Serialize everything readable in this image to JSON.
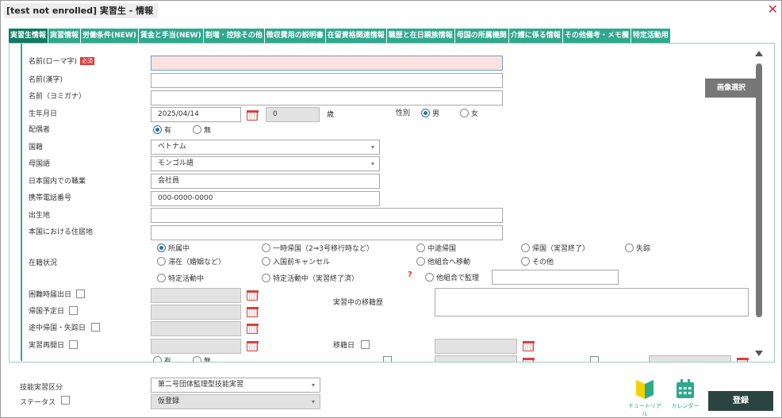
{
  "window": {
    "title": "[test not enrolled] 実習生 - 情報",
    "close_symbol": "✕"
  },
  "tabs": [
    {
      "label": "実習生情報",
      "active": true
    },
    {
      "label": "実習情報"
    },
    {
      "label": "労働条件(NEW)"
    },
    {
      "label": "賃金と手当(NEW)"
    },
    {
      "label": "割増・控除その他"
    },
    {
      "label": "徴収費用の説明書"
    },
    {
      "label": "在留資格関連情報"
    },
    {
      "label": "職歴と在日親族情報"
    },
    {
      "label": "母国の所属機関"
    },
    {
      "label": "介護に係る情報"
    },
    {
      "label": "その他備考・メモ欄"
    },
    {
      "label": "特定活動用"
    }
  ],
  "form": {
    "name_roman": {
      "label": "名前(ローマ字)",
      "badge": "必須",
      "value": ""
    },
    "name_kanji": {
      "label": "名前(漢字)",
      "value": ""
    },
    "name_kana": {
      "label": "名前（ヨミガナ）",
      "value": ""
    },
    "birthdate": {
      "label": "生年月日",
      "value": "2025/04/14",
      "age": "0",
      "age_unit": "歳"
    },
    "gender": {
      "label": "性別",
      "options": [
        "男",
        "女"
      ],
      "selected": "男"
    },
    "spouse": {
      "label": "配偶者",
      "options": [
        "有",
        "無"
      ],
      "selected": "有"
    },
    "nationality": {
      "label": "国籍",
      "value": "ベトナム"
    },
    "mother_tongue": {
      "label": "母国語",
      "value": "モンゴル語"
    },
    "job_in_japan": {
      "label": "日本国内での職業",
      "value": "会社員"
    },
    "mobile": {
      "label": "携帯電話番号",
      "placeholder": "000-0000-0000"
    },
    "birthplace": {
      "label": "出生地",
      "value": ""
    },
    "home_address": {
      "label": "本国における住居地",
      "value": ""
    },
    "status": {
      "label": "在籍状況",
      "row1": [
        "所属中",
        "一時帰国（2⇒3号移行時など）",
        "中途帰国",
        "帰国（実習終了）",
        "失踪"
      ],
      "row2": [
        "滞在（婚姻など）",
        "入国前キャンセル",
        "他組合へ移動",
        "その他"
      ],
      "row3": [
        "特定活動中",
        "特定活動中（実習終了済）",
        "他組合で監理"
      ],
      "selected": "所属中",
      "question_mark": "?"
    },
    "difficulty_date": {
      "label": "困難時届出日"
    },
    "return_date": {
      "label": "帰国予定日"
    },
    "midway_return_date": {
      "label": "途中帰国・失踪日"
    },
    "restart_date": {
      "label": "実習再開日"
    },
    "transfer_history": {
      "label": "実習中の移籍歴"
    },
    "transfer_date": {
      "label": "移籍日"
    },
    "cut_row": {
      "options": [
        "有",
        "無"
      ]
    }
  },
  "image_button": "画像選択",
  "bottom": {
    "training_type": {
      "label": "技能実習区分",
      "value": "第二号団体監理型技能実習"
    },
    "status": {
      "label": "ステータス",
      "value": "仮登録"
    },
    "tutorial_label": "チュートリアル",
    "calendar_label": "カレンダー",
    "register_button": "登録"
  },
  "colors": {
    "accent": "#2fa88e",
    "active_tab": "#117a62",
    "required": "#d9383a",
    "register": "#2b4440"
  }
}
